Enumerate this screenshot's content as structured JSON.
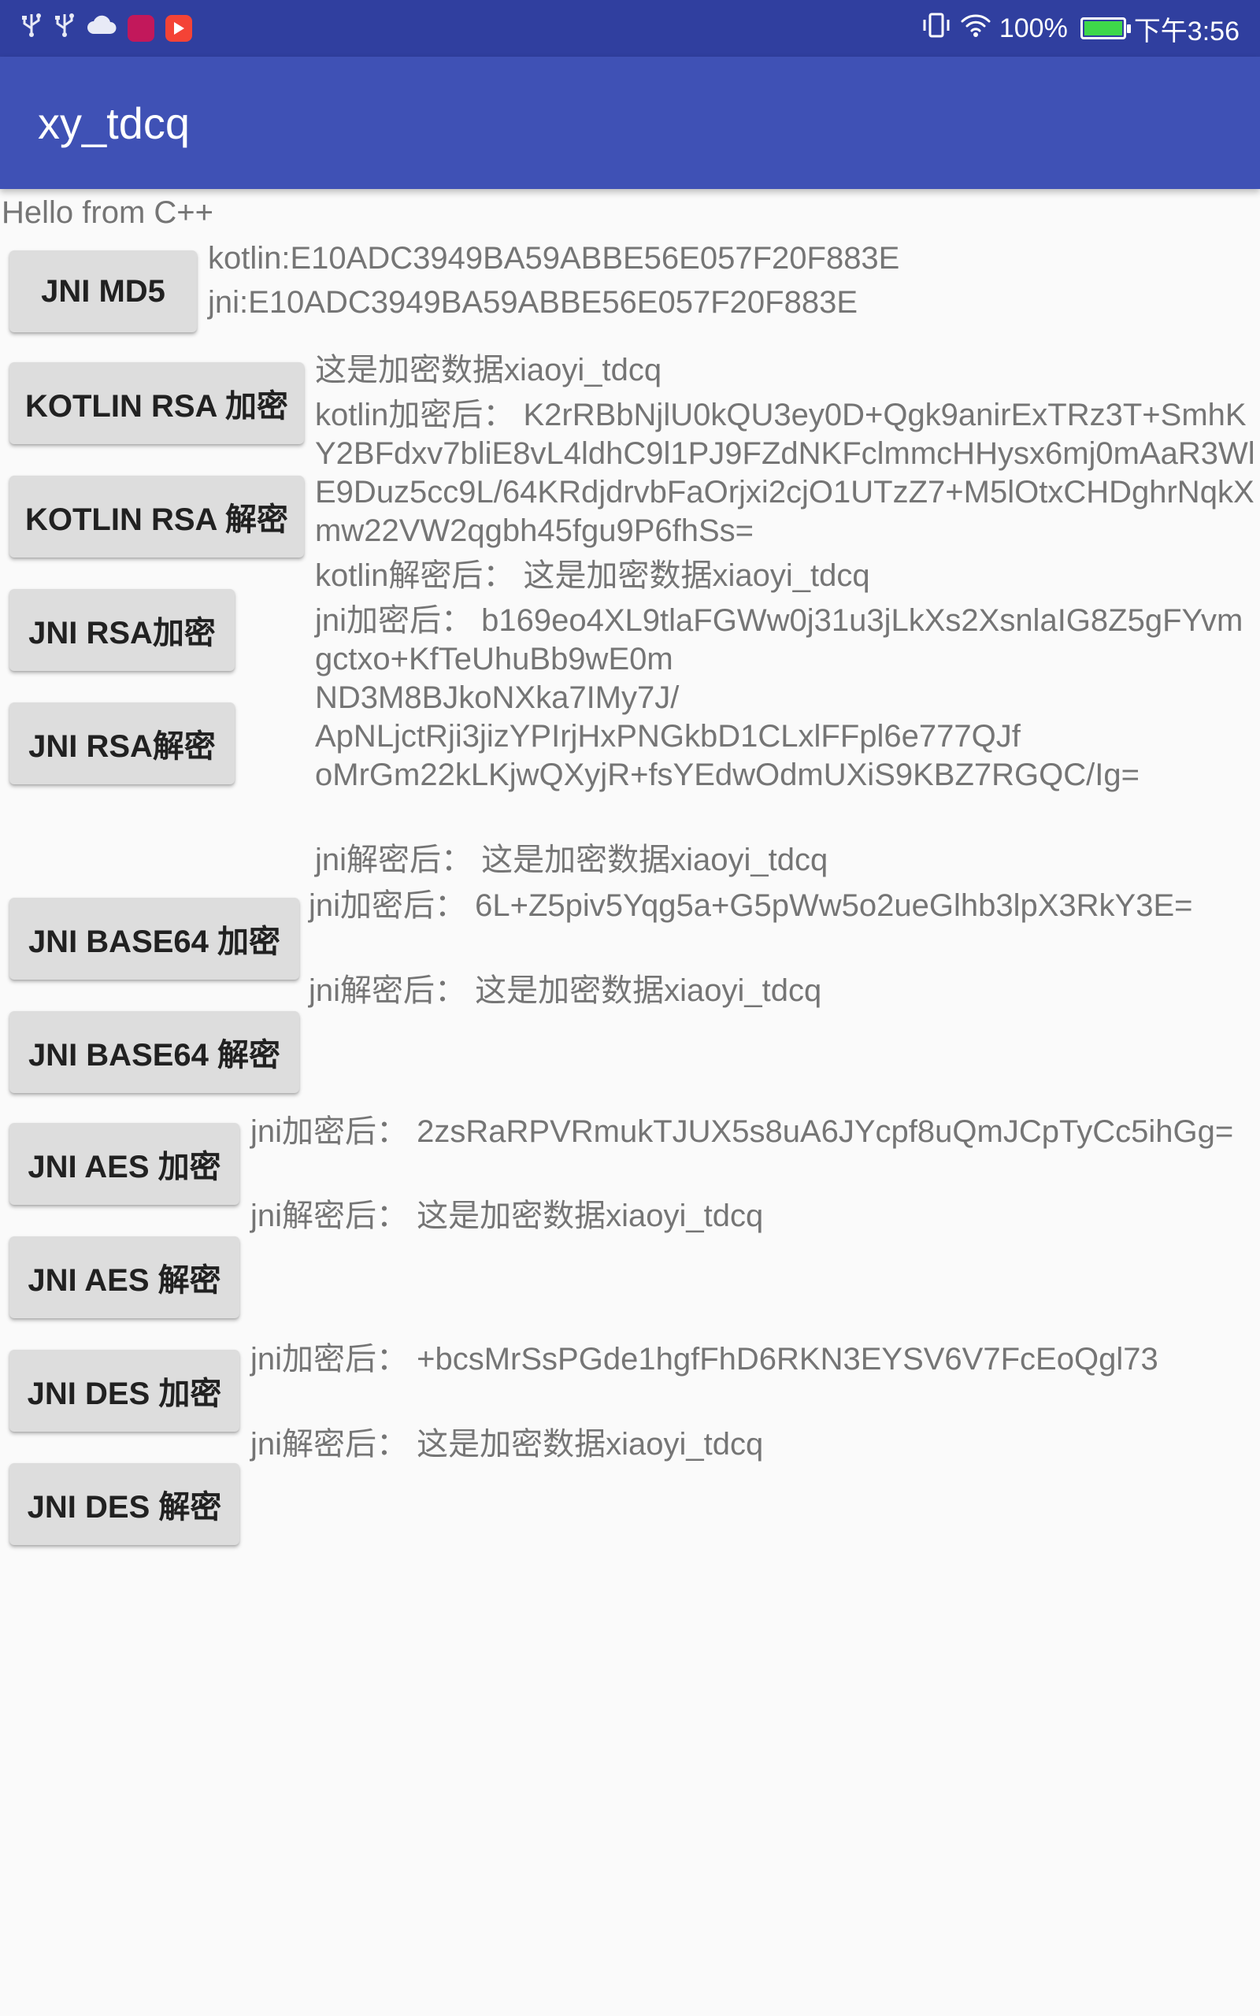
{
  "status_bar": {
    "icons_left": [
      "usb-icon",
      "usb-icon",
      "cloud-icon",
      "app-icon",
      "app-icon"
    ],
    "battery_percent": "100%",
    "battery_level": 1.0,
    "time": "下午3:56",
    "colors": {
      "bar": "#303f9f",
      "battery_fill": "#3ed84a"
    }
  },
  "app_bar": {
    "title": "xy_tdcq",
    "color": "#3f51b5"
  },
  "hello_text": "Hello from C++",
  "md5": {
    "button": "JNI MD5",
    "kotlin_result": "kotlin:E10ADC3949BA59ABBE56E057F20F883E",
    "jni_result": "jni:E10ADC3949BA59ABBE56E057F20F883E"
  },
  "rsa": {
    "kotlin_encrypt_button": "KOTLIN RSA 加密",
    "kotlin_decrypt_button": "KOTLIN RSA 解密",
    "jni_encrypt_button": "JNI RSA加密",
    "jni_decrypt_button": "JNI RSA解密",
    "plaintext": "这是加密数据xiaoyi_tdcq",
    "kotlin_encrypted": "kotlin加密后： K2rRBbNjlU0kQU3ey0D+Qgk9anirExTRz3T+SmhKY2BFdxv7bliE8vL4ldhC9l1PJ9FZdNKFclmmcHHysx6mj0mAaR3WlE9Duz5cc9L/64KRdjdrvbFaOrjxi2cjO1UTzZ7+M5lOtxCHDghrNqkXmw22VW2qgbh45fgu9P6fhSs=",
    "kotlin_decrypted": "kotlin解密后： 这是加密数据xiaoyi_tdcq",
    "jni_encrypted": "jni加密后： b169eo4XL9tlaFGWw0j31u3jLkXs2XsnlaIG8Z5gFYvmgctxo+KfTeUhuBb9wE0m\nND3M8BJkoNXka7IMy7J/\nApNLjctRji3jizYPIrjHxPNGkbD1CLxlFFpl6e777QJf\noMrGm22kLKjwQXyjR+fsYEdwOdmUXiS9KBZ7RGQC/Ig=",
    "jni_decrypted": "jni解密后： 这是加密数据xiaoyi_tdcq"
  },
  "base64": {
    "encrypt_button": "JNI BASE64 加密",
    "decrypt_button": "JNI BASE64 解密",
    "encrypted": "jni加密后： 6L+Z5piv5Yqg5a+G5pWw5o2ueGlhb3lpX3RkY3E=",
    "decrypted": "jni解密后： 这是加密数据xiaoyi_tdcq"
  },
  "aes": {
    "encrypt_button": "JNI AES 加密",
    "decrypt_button": "JNI AES 解密",
    "encrypted": "jni加密后： 2zsRaRPVRmukTJUX5s8uA6JYcpf8uQmJCpTyCc5ihGg=",
    "decrypted": "jni解密后： 这是加密数据xiaoyi_tdcq"
  },
  "des": {
    "encrypt_button": "JNI DES 加密",
    "decrypt_button": "JNI DES 解密",
    "encrypted": "jni加密后： +bcsMrSsPGde1hgfFhD6RKN3EYSV6V7FcEoQgl73",
    "decrypted": "jni解密后： 这是加密数据xiaoyi_tdcq"
  }
}
